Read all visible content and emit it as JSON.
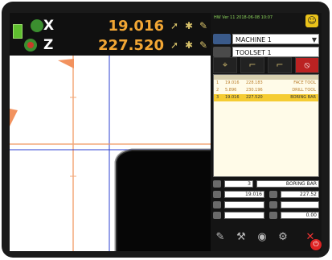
{
  "readout": {
    "x_letter": "X",
    "x_value": "19.016",
    "z_letter": "Z",
    "z_value": "227.520"
  },
  "panel": {
    "version_text": "HW Ver 11 2018-06-08 10:07",
    "machine_select": "MACHINE 1",
    "toolset_select": "TOOLSET 1",
    "table": {
      "rows": [
        {
          "num": "1",
          "x": "19.016",
          "z": "228.183",
          "name": "FACE TOOL"
        },
        {
          "num": "2",
          "x": "5.896",
          "z": "230.196",
          "name": "DRILL TOOL"
        },
        {
          "num": "3",
          "x": "19.016",
          "z": "227.520",
          "name": "BORING BAR"
        }
      ]
    },
    "edit": {
      "tool_number": "3",
      "tool_name": "BORING BAR",
      "x_value": "19.016",
      "z_value": "227.52",
      "last_value": "0.00"
    }
  },
  "colors": {
    "readout_value": "#f2a634",
    "accent_green": "#3b8e2f",
    "selected_row": "#f5cc32",
    "close": "#e33333"
  }
}
